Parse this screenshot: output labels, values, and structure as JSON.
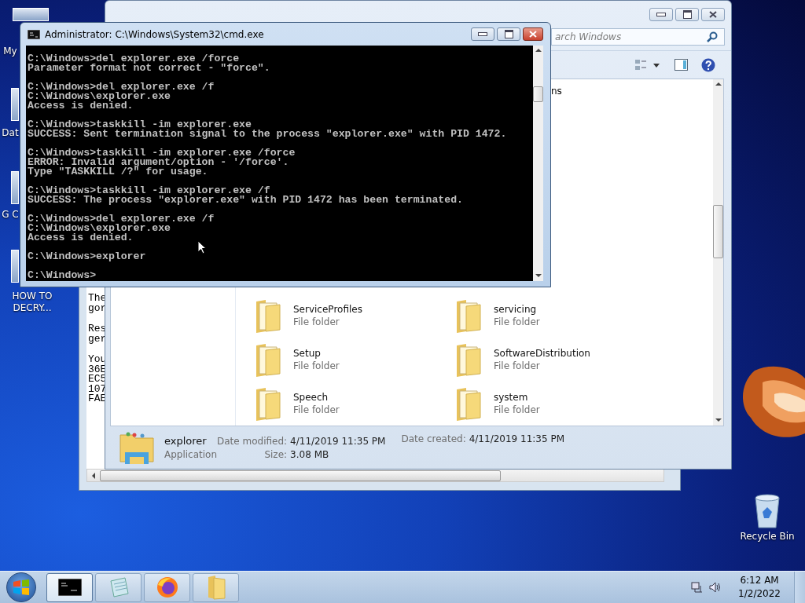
{
  "desktop_icons": [
    {
      "label": "My"
    },
    {
      "label": "Dat"
    },
    {
      "label": "G C"
    },
    {
      "label": "HOW TO DECRY..."
    }
  ],
  "recycle_bin": {
    "label": "Recycle Bin"
  },
  "notepad": {
    "paragraphs": [
      [
        "The",
        "gor"
      ],
      [
        "Res",
        "ger"
      ],
      [
        "You",
        "36E",
        "EC5",
        "107",
        "FAE"
      ]
    ]
  },
  "explorer": {
    "search": {
      "placeholder": "arch Windows"
    },
    "partial_item": "ns",
    "items": [
      {
        "name": "ServiceProfiles",
        "type": "File folder"
      },
      {
        "name": "servicing",
        "type": "File folder"
      },
      {
        "name": "Setup",
        "type": "File folder"
      },
      {
        "name": "SoftwareDistribution",
        "type": "File folder"
      },
      {
        "name": "Speech",
        "type": "File folder"
      },
      {
        "name": "system",
        "type": "File folder"
      }
    ],
    "details": {
      "name": "explorer",
      "type": "Application",
      "columns": [
        [
          {
            "label": "Date modified:",
            "value": "4/11/2019 11:35 PM"
          },
          {
            "label": "Size:",
            "value": "3.08 MB"
          }
        ],
        [
          {
            "label": "Date created:",
            "value": "4/11/2019 11:35 PM"
          }
        ]
      ]
    }
  },
  "cmd": {
    "title": "Administrator: C:\\Windows\\System32\\cmd.exe",
    "blocks": [
      [
        "C:\\Windows>del explorer.exe /force",
        "Parameter format not correct - \"force\"."
      ],
      [
        "C:\\Windows>del explorer.exe /f",
        "C:\\Windows\\explorer.exe",
        "Access is denied."
      ],
      [
        "C:\\Windows>taskkill -im explorer.exe",
        "SUCCESS: Sent termination signal to the process \"explorer.exe\" with PID 1472."
      ],
      [
        "C:\\Windows>taskkill -im explorer.exe /force",
        "ERROR: Invalid argument/option - '/force'.",
        "Type \"TASKKILL /?\" for usage."
      ],
      [
        "C:\\Windows>taskkill -im explorer.exe /f",
        "SUCCESS: The process \"explorer.exe\" with PID 1472 has been terminated."
      ],
      [
        "C:\\Windows>del explorer.exe /f",
        "C:\\Windows\\explorer.exe",
        "Access is denied."
      ],
      [
        "C:\\Windows>explorer"
      ],
      [
        "C:\\Windows>"
      ]
    ]
  },
  "taskbar": {
    "buttons": [
      {
        "kind": "cmd",
        "selected": true
      },
      {
        "kind": "notepad",
        "selected": false
      },
      {
        "kind": "firefox",
        "selected": false
      },
      {
        "kind": "folder",
        "selected": false
      }
    ],
    "time": "6:12 AM",
    "date": "1/2/2022"
  }
}
